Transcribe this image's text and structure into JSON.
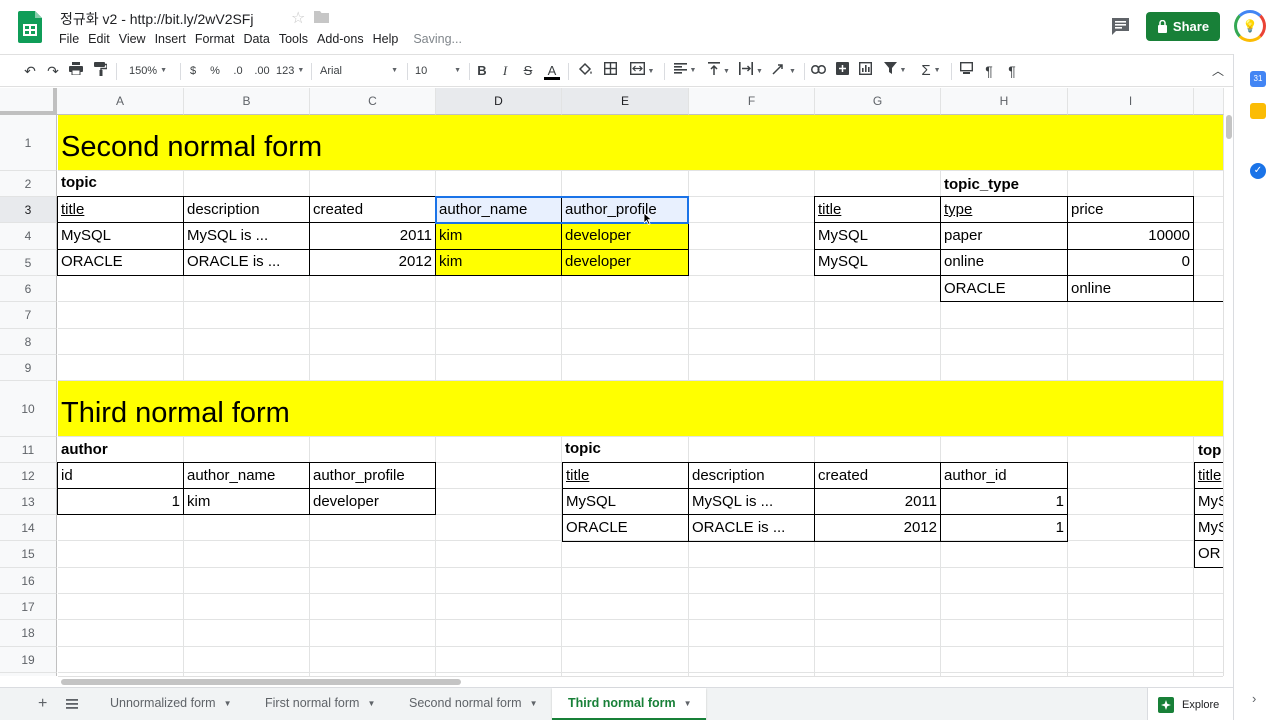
{
  "header": {
    "doc_title": "정규화 v2  -  http://bit.ly/2wV2SFj",
    "menu": [
      "File",
      "Edit",
      "View",
      "Insert",
      "Format",
      "Data",
      "Tools",
      "Add-ons",
      "Help"
    ],
    "status": "Saving...",
    "share_label": "Share",
    "colors": {
      "brand_green": "#188038",
      "band_yellow": "#ffff00",
      "selection_blue": "#1a73e8"
    }
  },
  "toolbar": {
    "zoom": "150%",
    "currency": "$",
    "percent": "%",
    "decimal_less": ".0",
    "decimal_more": ".00",
    "number_format": "123",
    "font": "Arial",
    "font_size": "10",
    "bold": "B",
    "italic": "I",
    "strike": "S",
    "text_color": "A"
  },
  "columns": [
    "A",
    "B",
    "C",
    "D",
    "E",
    "F",
    "G",
    "H",
    "I"
  ],
  "rows": [
    "1",
    "2",
    "3",
    "4",
    "5",
    "6",
    "7",
    "8",
    "9",
    "10",
    "11",
    "12",
    "13",
    "14",
    "15",
    "16",
    "17",
    "18",
    "19"
  ],
  "sections": {
    "second": {
      "title": "Second normal form",
      "topic_label": "topic",
      "topic_header": [
        "title",
        "description",
        "created",
        "author_name",
        "author_profile"
      ],
      "topic_rows": [
        [
          "MySQL",
          "MySQL is ...",
          "2011",
          "kim",
          "developer"
        ],
        [
          "ORACLE",
          "ORACLE is ...",
          "2012",
          "kim",
          "developer"
        ]
      ],
      "topic_type_label": "topic_type",
      "topic_type_header": [
        "title",
        "type",
        "price"
      ],
      "topic_type_rows": [
        [
          "MySQL",
          "paper",
          "10000"
        ],
        [
          "MySQL",
          "online",
          "0"
        ],
        [
          "",
          "ORACLE",
          "online"
        ]
      ]
    },
    "third": {
      "title": "Third normal form",
      "author_label": "author",
      "author_header": [
        "id",
        "author_name",
        "author_profile"
      ],
      "author_rows": [
        [
          "1",
          "kim",
          "developer"
        ]
      ],
      "topic_label": "topic",
      "topic_header": [
        "title",
        "description",
        "created",
        "author_id"
      ],
      "topic_rows": [
        [
          "MySQL",
          "MySQL is ...",
          "2011",
          "1"
        ],
        [
          "ORACLE",
          "ORACLE is ...",
          "2012",
          "1"
        ]
      ],
      "clipped_label": "top",
      "clipped_cells": [
        "title",
        "MyS",
        "MyS",
        "OR"
      ]
    }
  },
  "sheet_tabs": [
    {
      "label": "Unnormalized form",
      "active": false
    },
    {
      "label": "First normal form",
      "active": false
    },
    {
      "label": "Second normal form",
      "active": false
    },
    {
      "label": "Third normal form",
      "active": true
    }
  ],
  "explore_label": "Explore"
}
